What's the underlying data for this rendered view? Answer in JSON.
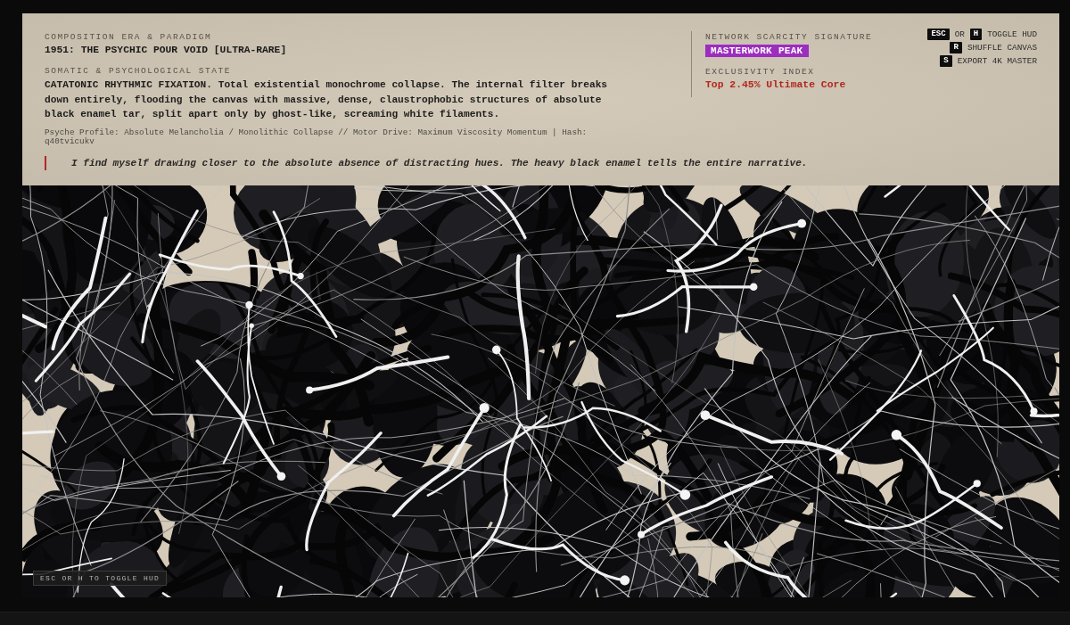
{
  "hud": {
    "era": {
      "label": "COMPOSITION ERA & PARADIGM",
      "title": "1951: THE PSYCHIC POUR VOID [ULTRA-RARE]"
    },
    "state": {
      "label": "SOMATIC & PSYCHOLOGICAL STATE",
      "description": "CATATONIC RHYTHMIC FIXATION. Total existential monochrome collapse. The internal filter breaks down entirely, flooding the canvas with massive, dense, claustrophobic structures of absolute black enamel tar, split apart only by ghost-like, screaming white filaments."
    },
    "profile": "Psyche Profile: Absolute Melancholia / Monolithic Collapse // Motor Drive: Maximum Viscosity Momentum | Hash: q40tvicukv",
    "quote": "I find myself drawing closer to the absolute absence of distracting hues. The heavy black enamel tells the entire narrative.",
    "rarity": {
      "label": "NETWORK SCARCITY SIGNATURE",
      "badge": "MASTERWORK PEAK"
    },
    "exclusivity": {
      "label": "EXCLUSIVITY INDEX",
      "value": "Top 2.45% Ultimate Core"
    },
    "shortcuts": [
      {
        "parts": [
          {
            "kind": "key",
            "text": "ESC"
          },
          {
            "kind": "text",
            "text": "OR"
          },
          {
            "kind": "key",
            "text": "H"
          },
          {
            "kind": "text",
            "text": "TOGGLE HUD"
          }
        ]
      },
      {
        "parts": [
          {
            "kind": "key",
            "text": "R"
          },
          {
            "kind": "text",
            "text": "SHUFFLE CANVAS"
          }
        ]
      },
      {
        "parts": [
          {
            "kind": "key",
            "text": "S"
          },
          {
            "kind": "text",
            "text": "EXPORT 4K MASTER"
          }
        ]
      }
    ]
  },
  "hint": "ESC OR H TO TOGGLE HUD"
}
